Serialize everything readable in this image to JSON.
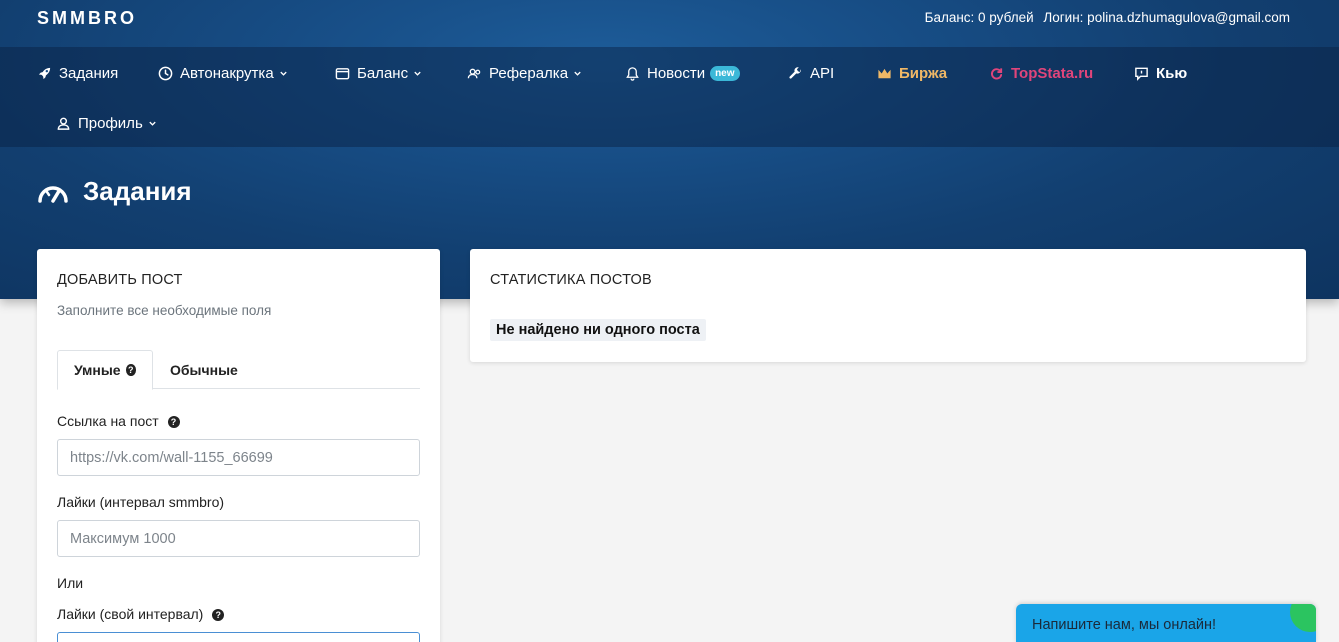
{
  "brand": "SMMBRO",
  "topbar": {
    "balance": "Баланс: 0 рублей",
    "login": "Логин: polina.dzhumagulova@gmail.com"
  },
  "nav": {
    "items": [
      {
        "label": "Задания",
        "icon": "rocket-icon"
      },
      {
        "label": "Автонакрутка",
        "icon": "clock-icon",
        "dropdown": true
      },
      {
        "label": "Баланс",
        "icon": "wallet-icon",
        "dropdown": true
      },
      {
        "label": "Рефералка",
        "icon": "users-icon",
        "dropdown": true
      },
      {
        "label": "Новости",
        "icon": "bell-icon",
        "badge": "new"
      },
      {
        "label": "API",
        "icon": "wrench-icon"
      },
      {
        "label": "Биржа",
        "icon": "crown-icon",
        "color": "#f0b866"
      },
      {
        "label": "TopStata.ru",
        "icon": "refresh-icon",
        "color": "#e0457b"
      },
      {
        "label": "Кью",
        "icon": "chat-icon"
      },
      {
        "label": "Профиль",
        "icon": "user-icon",
        "dropdown": true
      }
    ]
  },
  "page": {
    "title": "Задания",
    "icon": "gauge-icon"
  },
  "add_post": {
    "title": "ДОБАВИТЬ ПОСТ",
    "subtitle": "Заполните все необходимые поля",
    "tabs": [
      {
        "label": "Умные",
        "active": true
      },
      {
        "label": "Обычные",
        "active": false
      }
    ],
    "link_label": "Ссылка на пост",
    "link_placeholder": "https://vk.com/wall-1155_66699",
    "likes_label": "Лайки (интервал smmbro)",
    "likes_placeholder": "Максимум 1000",
    "or_text": "Или",
    "custom_likes_label": "Лайки (свой интервал)"
  },
  "stats": {
    "title": "СТАТИСТИКА ПОСТОВ",
    "empty": "Не найдено ни одного поста"
  },
  "chat": {
    "text": "Напишите нам, мы онлайн!"
  }
}
